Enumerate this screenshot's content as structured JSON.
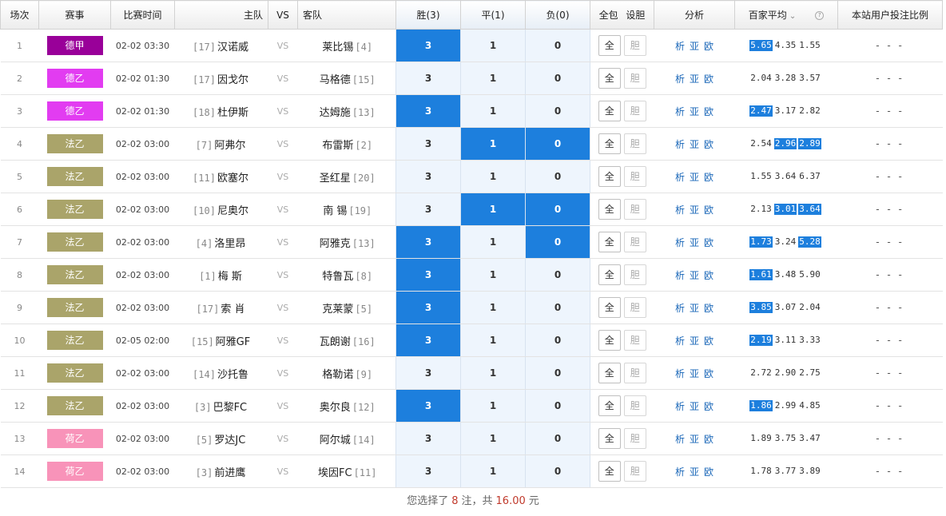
{
  "header": {
    "idx": "场次",
    "league": "赛事",
    "time": "比赛时间",
    "home": "主队",
    "vs": "VS",
    "away": "客队",
    "win": "胜(3)",
    "draw": "平(1)",
    "lose": "负(0)",
    "all": "全包",
    "set_dan": "设胆",
    "analysis": "分析",
    "odds_avg": "百家平均",
    "ratio": "本站用户投注比例"
  },
  "labels": {
    "vs": "VS",
    "btn_all": "全",
    "btn_dan": "胆",
    "link_xi": "析",
    "link_ya": "亚",
    "link_ou": "欧",
    "ratio_placeholder": "- - -"
  },
  "colors": {
    "德甲": "#990099",
    "德乙": "#e23cf1",
    "法乙": "#aaa46a",
    "荷乙": "#f893b9",
    "selected": "#1d7fdd"
  },
  "matches": [
    {
      "idx": "1",
      "league": "德甲",
      "time": "02-02 03:30",
      "home_rank": "[17]",
      "home": "汉诺威",
      "away": "莱比锡",
      "away_rank": "[4]",
      "win": "3",
      "draw": "1",
      "lose": "0",
      "sel": [
        true,
        false,
        false
      ],
      "odds": [
        "5.65",
        "4.35",
        "1.55"
      ],
      "odds_hi": [
        true,
        false,
        false
      ]
    },
    {
      "idx": "2",
      "league": "德乙",
      "time": "02-02 01:30",
      "home_rank": "[17]",
      "home": "因戈尔",
      "away": "马格德",
      "away_rank": "[15]",
      "win": "3",
      "draw": "1",
      "lose": "0",
      "sel": [
        false,
        false,
        false
      ],
      "odds": [
        "2.04",
        "3.28",
        "3.57"
      ],
      "odds_hi": [
        false,
        false,
        false
      ]
    },
    {
      "idx": "3",
      "league": "德乙",
      "time": "02-02 01:30",
      "home_rank": "[18]",
      "home": "杜伊斯",
      "away": "达姆施",
      "away_rank": "[13]",
      "win": "3",
      "draw": "1",
      "lose": "0",
      "sel": [
        true,
        false,
        false
      ],
      "odds": [
        "2.47",
        "3.17",
        "2.82"
      ],
      "odds_hi": [
        true,
        false,
        false
      ]
    },
    {
      "idx": "4",
      "league": "法乙",
      "time": "02-02 03:00",
      "home_rank": "[7]",
      "home": "阿弗尔",
      "away": "布雷斯",
      "away_rank": "[2]",
      "win": "3",
      "draw": "1",
      "lose": "0",
      "sel": [
        false,
        true,
        true
      ],
      "odds": [
        "2.54",
        "2.96",
        "2.89"
      ],
      "odds_hi": [
        false,
        true,
        true
      ]
    },
    {
      "idx": "5",
      "league": "法乙",
      "time": "02-02 03:00",
      "home_rank": "[11]",
      "home": "欧塞尔",
      "away": "圣红星",
      "away_rank": "[20]",
      "win": "3",
      "draw": "1",
      "lose": "0",
      "sel": [
        false,
        false,
        false
      ],
      "odds": [
        "1.55",
        "3.64",
        "6.37"
      ],
      "odds_hi": [
        false,
        false,
        false
      ]
    },
    {
      "idx": "6",
      "league": "法乙",
      "time": "02-02 03:00",
      "home_rank": "[10]",
      "home": "尼奥尔",
      "away": "南 锡",
      "away_rank": "[19]",
      "win": "3",
      "draw": "1",
      "lose": "0",
      "sel": [
        false,
        true,
        true
      ],
      "odds": [
        "2.13",
        "3.01",
        "3.64"
      ],
      "odds_hi": [
        false,
        true,
        true
      ]
    },
    {
      "idx": "7",
      "league": "法乙",
      "time": "02-02 03:00",
      "home_rank": "[4]",
      "home": "洛里昂",
      "away": "阿雅克",
      "away_rank": "[13]",
      "win": "3",
      "draw": "1",
      "lose": "0",
      "sel": [
        true,
        false,
        true
      ],
      "odds": [
        "1.73",
        "3.24",
        "5.28"
      ],
      "odds_hi": [
        true,
        false,
        true
      ]
    },
    {
      "idx": "8",
      "league": "法乙",
      "time": "02-02 03:00",
      "home_rank": "[1]",
      "home": "梅 斯",
      "away": "特鲁瓦",
      "away_rank": "[8]",
      "win": "3",
      "draw": "1",
      "lose": "0",
      "sel": [
        true,
        false,
        false
      ],
      "odds": [
        "1.61",
        "3.48",
        "5.90"
      ],
      "odds_hi": [
        true,
        false,
        false
      ]
    },
    {
      "idx": "9",
      "league": "法乙",
      "time": "02-02 03:00",
      "home_rank": "[17]",
      "home": "索 肖",
      "away": "克莱蒙",
      "away_rank": "[5]",
      "win": "3",
      "draw": "1",
      "lose": "0",
      "sel": [
        true,
        false,
        false
      ],
      "odds": [
        "3.85",
        "3.07",
        "2.04"
      ],
      "odds_hi": [
        true,
        false,
        false
      ]
    },
    {
      "idx": "10",
      "league": "法乙",
      "time": "02-05 02:00",
      "home_rank": "[15]",
      "home": "阿雅GF",
      "away": "瓦朗谢",
      "away_rank": "[16]",
      "win": "3",
      "draw": "1",
      "lose": "0",
      "sel": [
        true,
        false,
        false
      ],
      "odds": [
        "2.19",
        "3.11",
        "3.33"
      ],
      "odds_hi": [
        true,
        false,
        false
      ]
    },
    {
      "idx": "11",
      "league": "法乙",
      "time": "02-02 03:00",
      "home_rank": "[14]",
      "home": "沙托鲁",
      "away": "格勒诺",
      "away_rank": "[9]",
      "win": "3",
      "draw": "1",
      "lose": "0",
      "sel": [
        false,
        false,
        false
      ],
      "odds": [
        "2.72",
        "2.90",
        "2.75"
      ],
      "odds_hi": [
        false,
        false,
        false
      ]
    },
    {
      "idx": "12",
      "league": "法乙",
      "time": "02-02 03:00",
      "home_rank": "[3]",
      "home": "巴黎FC",
      "away": "奥尔良",
      "away_rank": "[12]",
      "win": "3",
      "draw": "1",
      "lose": "0",
      "sel": [
        true,
        false,
        false
      ],
      "odds": [
        "1.86",
        "2.99",
        "4.85"
      ],
      "odds_hi": [
        true,
        false,
        false
      ]
    },
    {
      "idx": "13",
      "league": "荷乙",
      "time": "02-02 03:00",
      "home_rank": "[5]",
      "home": "罗达JC",
      "away": "阿尔城",
      "away_rank": "[14]",
      "win": "3",
      "draw": "1",
      "lose": "0",
      "sel": [
        false,
        false,
        false
      ],
      "odds": [
        "1.89",
        "3.75",
        "3.47"
      ],
      "odds_hi": [
        false,
        false,
        false
      ]
    },
    {
      "idx": "14",
      "league": "荷乙",
      "time": "02-02 03:00",
      "home_rank": "[3]",
      "home": "前进鹰",
      "away": "埃因FC",
      "away_rank": "[11]",
      "win": "3",
      "draw": "1",
      "lose": "0",
      "sel": [
        false,
        false,
        false
      ],
      "odds": [
        "1.78",
        "3.77",
        "3.89"
      ],
      "odds_hi": [
        false,
        false,
        false
      ]
    }
  ],
  "summary": {
    "prefix": "您选择了",
    "count": "8",
    "mid": "注，共",
    "amount": "16.00",
    "suffix": "元"
  }
}
